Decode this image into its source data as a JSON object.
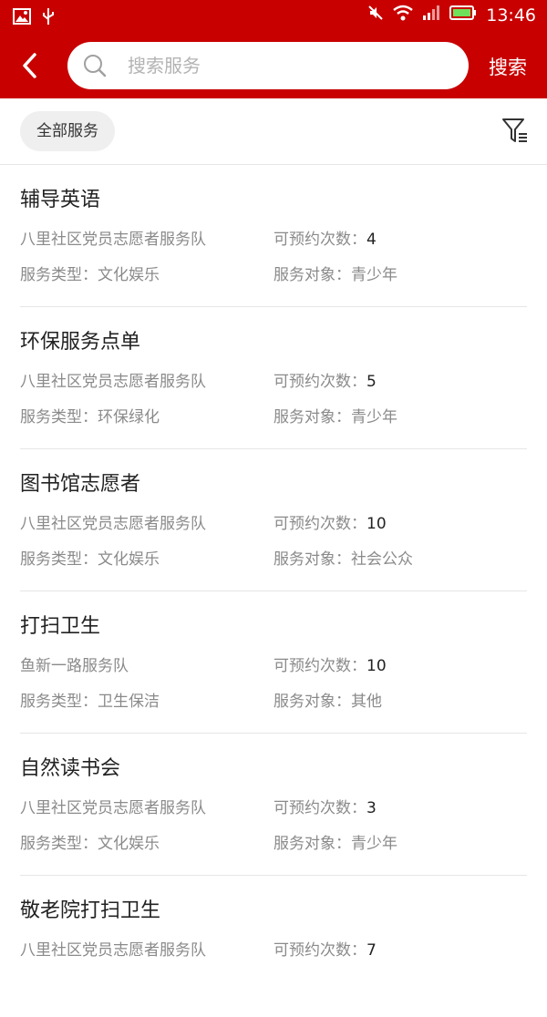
{
  "status_bar": {
    "time": "13:46"
  },
  "header": {
    "search_placeholder": "搜索服务",
    "search_button": "搜索"
  },
  "filter": {
    "chip_label": "全部服务"
  },
  "labels": {
    "appointments": "可预约次数：",
    "service_type": "服务类型：",
    "service_target": "服务对象："
  },
  "services": [
    {
      "title": "辅导英语",
      "team": "八里社区党员志愿者服务队",
      "count": "4",
      "type": "文化娱乐",
      "target": "青少年"
    },
    {
      "title": "环保服务点单",
      "team": "八里社区党员志愿者服务队",
      "count": "5",
      "type": "环保绿化",
      "target": "青少年"
    },
    {
      "title": "图书馆志愿者",
      "team": "八里社区党员志愿者服务队",
      "count": "10",
      "type": "文化娱乐",
      "target": "社会公众"
    },
    {
      "title": "打扫卫生",
      "team": "鱼新一路服务队",
      "count": "10",
      "type": "卫生保洁",
      "target": "其他"
    },
    {
      "title": "自然读书会",
      "team": "八里社区党员志愿者服务队",
      "count": "3",
      "type": "文化娱乐",
      "target": "青少年"
    },
    {
      "title": "敬老院打扫卫生",
      "team": "八里社区党员志愿者服务队",
      "count": "7",
      "type": "",
      "target": ""
    }
  ]
}
